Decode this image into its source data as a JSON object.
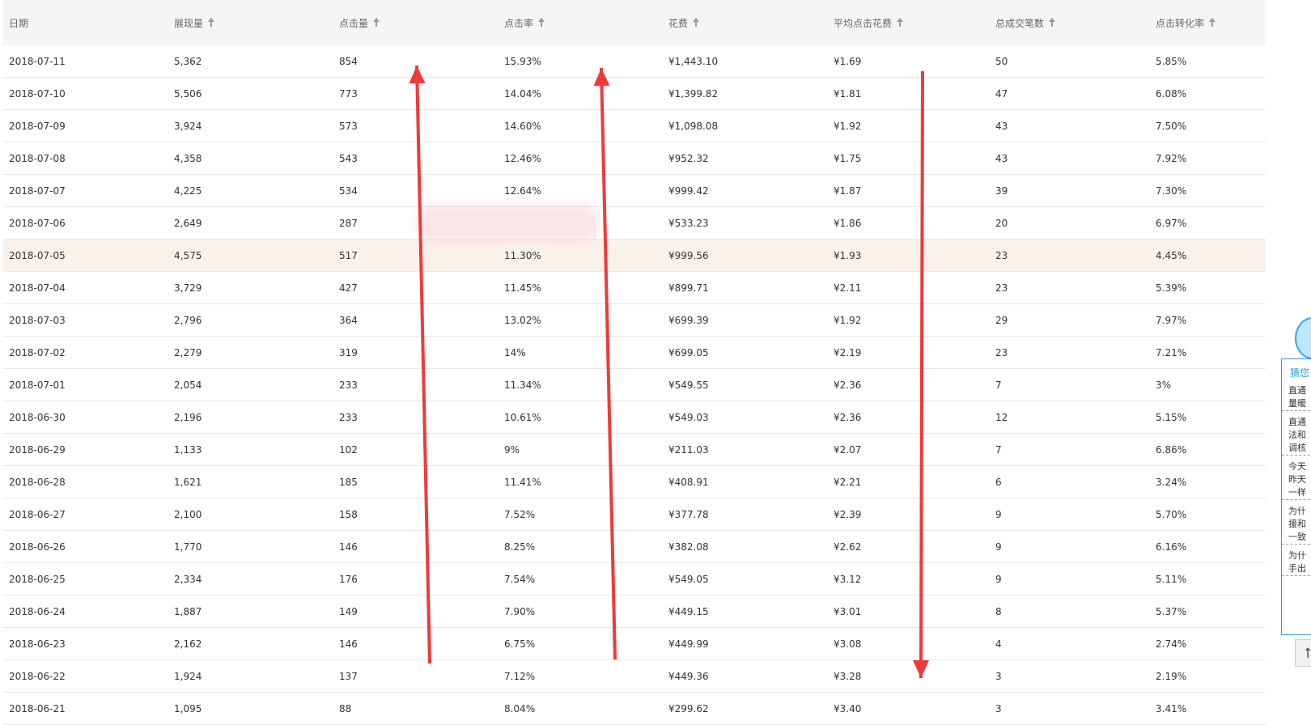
{
  "table": {
    "headers": [
      "日期",
      "展现量",
      "点击量",
      "点击率",
      "花费",
      "平均点击花费",
      "总成交笔数",
      "点击转化率"
    ],
    "rows": [
      [
        "2018-07-11",
        "5,362",
        "854",
        "15.93%",
        "¥1,443.10",
        "¥1.69",
        "50",
        "5.85%"
      ],
      [
        "2018-07-10",
        "5,506",
        "773",
        "14.04%",
        "¥1,399.82",
        "¥1.81",
        "47",
        "6.08%"
      ],
      [
        "2018-07-09",
        "3,924",
        "573",
        "14.60%",
        "¥1,098.08",
        "¥1.92",
        "43",
        "7.50%"
      ],
      [
        "2018-07-08",
        "4,358",
        "543",
        "12.46%",
        "¥952.32",
        "¥1.75",
        "43",
        "7.92%"
      ],
      [
        "2018-07-07",
        "4,225",
        "534",
        "12.64%",
        "¥999.42",
        "¥1.87",
        "39",
        "7.30%"
      ],
      [
        "2018-07-06",
        "2,649",
        "287",
        "",
        "¥533.23",
        "¥1.86",
        "20",
        "6.97%"
      ],
      [
        "2018-07-05",
        "4,575",
        "517",
        "11.30%",
        "¥999.56",
        "¥1.93",
        "23",
        "4.45%"
      ],
      [
        "2018-07-04",
        "3,729",
        "427",
        "11.45%",
        "¥899.71",
        "¥2.11",
        "23",
        "5.39%"
      ],
      [
        "2018-07-03",
        "2,796",
        "364",
        "13.02%",
        "¥699.39",
        "¥1.92",
        "29",
        "7.97%"
      ],
      [
        "2018-07-02",
        "2,279",
        "319",
        "14%",
        "¥699.05",
        "¥2.19",
        "23",
        "7.21%"
      ],
      [
        "2018-07-01",
        "2,054",
        "233",
        "11.34%",
        "¥549.55",
        "¥2.36",
        "7",
        "3%"
      ],
      [
        "2018-06-30",
        "2,196",
        "233",
        "10.61%",
        "¥549.03",
        "¥2.36",
        "12",
        "5.15%"
      ],
      [
        "2018-06-29",
        "1,133",
        "102",
        "9%",
        "¥211.03",
        "¥2.07",
        "7",
        "6.86%"
      ],
      [
        "2018-06-28",
        "1,621",
        "185",
        "11.41%",
        "¥408.91",
        "¥2.21",
        "6",
        "3.24%"
      ],
      [
        "2018-06-27",
        "2,100",
        "158",
        "7.52%",
        "¥377.78",
        "¥2.39",
        "9",
        "5.70%"
      ],
      [
        "2018-06-26",
        "1,770",
        "146",
        "8.25%",
        "¥382.08",
        "¥2.62",
        "9",
        "6.16%"
      ],
      [
        "2018-06-25",
        "2,334",
        "176",
        "7.54%",
        "¥549.05",
        "¥3.12",
        "9",
        "5.11%"
      ],
      [
        "2018-06-24",
        "1,887",
        "149",
        "7.90%",
        "¥449.15",
        "¥3.01",
        "8",
        "5.37%"
      ],
      [
        "2018-06-23",
        "2,162",
        "146",
        "6.75%",
        "¥449.99",
        "¥3.08",
        "4",
        "2.74%"
      ],
      [
        "2018-06-22",
        "1,924",
        "137",
        "7.12%",
        "¥449.36",
        "¥3.28",
        "3",
        "2.19%"
      ],
      [
        "2018-06-21",
        "1,095",
        "88",
        "8.04%",
        "¥299.62",
        "¥3.40",
        "3",
        "3.41%"
      ]
    ],
    "highlighted_row": 6
  },
  "annotations": {
    "arrow_color": "#ee3a3a"
  },
  "side_panel": {
    "title": "猜您",
    "items": [
      "直通\n量暖",
      "直通\n法和\n调核",
      "今天\n昨天\n一样",
      "为什\n援和\n一致",
      "为什\n手出"
    ]
  },
  "back_to_top_icon": "arrow-up-icon"
}
